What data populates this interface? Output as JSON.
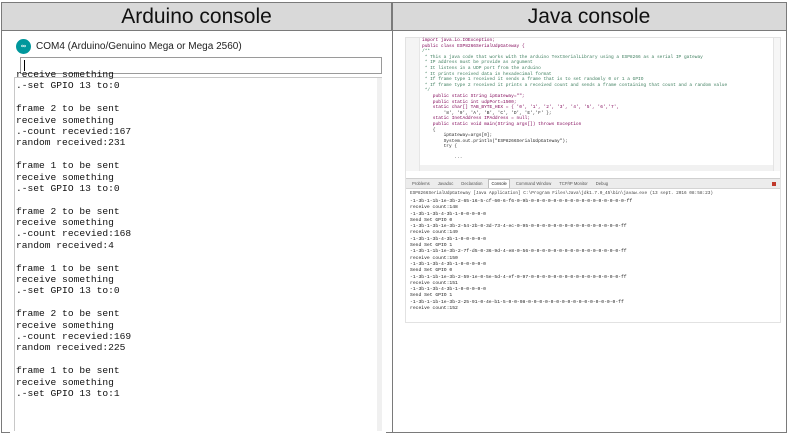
{
  "headers": {
    "left": "Arduino console",
    "right": "Java console"
  },
  "arduino": {
    "window_title": "COM4 (Arduino/Genuino Mega or Mega 2560)",
    "logo_text": "∞",
    "lines": [
      "receive something",
      ".-set GPIO 13 to:0",
      "",
      "frame 2 to be sent",
      "receive something",
      ".-count recevied:167",
      "random received:231",
      "",
      "frame 1 to be sent",
      "receive something",
      ".-set GPIO 13 to:0",
      "",
      "frame 2 to be sent",
      "receive something",
      ".-count recevied:168",
      "random received:4",
      "",
      "frame 1 to be sent",
      "receive something",
      ".-set GPIO 13 to:0",
      "",
      "frame 2 to be sent",
      "receive something",
      ".-count recevied:169",
      "random received:225",
      "",
      "frame 1 to be sent",
      "receive something",
      ".-set GPIO 13 to:1"
    ]
  },
  "java": {
    "code_lines": [
      "import java.io.IOException;",
      "public class ESP8266SerialUdpGateway {",
      "/**",
      " * This a java code that works with the arduino TextSerialLibrary using a ESP8266 as a serial IP gateway",
      " * IP address must be provide as argument",
      " * It listens in a UDP port from the arduino",
      " * It prints received data in hexadecimal format",
      " * If frame type 1 received it sends a frame that is to set randomly 0 or 1 a GPIO",
      " * If frame type 2 received it prints a received count and sends a frame containing that count and a random value",
      " */",
      "    public static String ipGateway=\"\";",
      "    public static int udpPort=1500;",
      "    static char[] TAB_BYTE_HEX = { '0', '1', '2', '3', '4', '5', '6','7',",
      "        '8', '9', 'A', 'B', 'C', 'D', 'E','F' };",
      "    static InetAddress IPAddress = null;",
      "    public static void main(String args[]) throws Exception",
      "    {",
      "        ipGateway=args[0];",
      "        System.out.println(\"ESP8266SerialUdpGateway\");",
      "        try {",
      "",
      "            ..."
    ],
    "tabs": [
      "Problems",
      "Javadoc",
      "Declaration",
      "Console",
      "Command Window",
      "TCP/IP Monitor",
      "Debug"
    ],
    "terminated_line": "ESP8266SerialUdpGateway [Java Application] C:\\Program Files\\Java\\jdk1.7.0_45\\bin\\javaw.exe (13 sept. 2016 08:58:23)",
    "console_lines": [
      "-1-3b-1-1b-1e-3b-2-65-16-5-cf-60-6-f6-0-9b-0-0-0-0-0-0-0-0-0-0-0-0-0-0-0-0-0-ff",
      "receive count:148",
      "-1-3b-1-3b-4-3b-1-0-0-0-0-0",
      "Send Set GPIO 0",
      "-1-3b-1-3b-1e-3b-2-54-2b-0-3d-73-4-ec-0-95-0-0-0-0-0-0-0-0-0-0-0-0-0-0-0-0-ff",
      "receive count:149",
      "-1-3b-1-3b-4-3b-1-0-0-0-0-0",
      "Send Set GPIO 1",
      "-1-3b-1-1b-1e-3b-2-7f-d5-0-36-9d-4-e8-0-56-0-0-0-0-0-0-0-0-0-0-0-0-0-0-0-0-ff",
      "receive count:150",
      "-1-3b-1-3b-4-3b-1-0-0-0-0-0",
      "Send Set GPIO 0",
      "-1-3b-1-1b-1e-3b-2-59-1e-0-5e-5d-4-ef-0-97-0-0-0-0-0-0-0-0-0-0-0-0-0-0-0-0-ff",
      "receive count:151",
      "-1-3b-1-3b-4-3b-1-0-0-0-0-0",
      "Send Set GPIO 1",
      "-1-3b-1-1b-1e-3b-2-25-91-0-4e-b1-5-0-0-98-0-0-0-0-0-0-0-0-0-0-0-0-0-0-0-0-ff",
      "receive count:152"
    ]
  }
}
